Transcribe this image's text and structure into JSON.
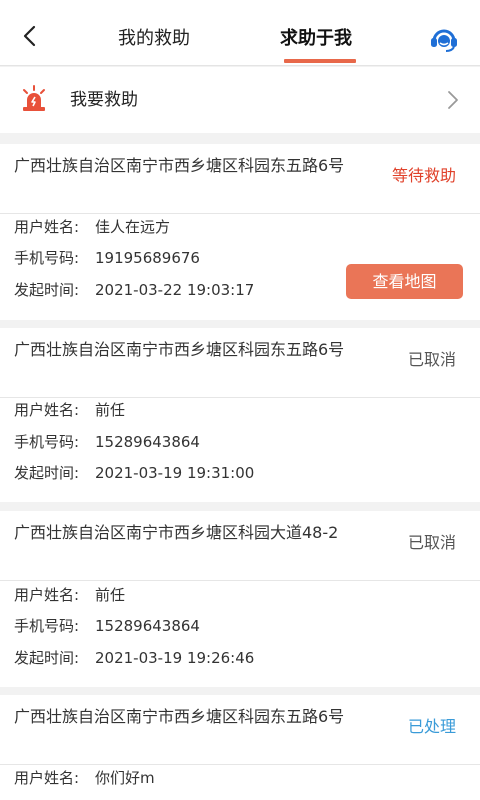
{
  "header": {
    "tabs": [
      {
        "label": "我的救助",
        "active": false
      },
      {
        "label": "求助于我",
        "active": true
      }
    ],
    "accent": "#e8684a"
  },
  "rescue_entry": {
    "label": "我要救助"
  },
  "field_labels": {
    "name": "用户姓名:",
    "phone": "手机号码:",
    "time": "发起时间:"
  },
  "map_button_label": "查看地图",
  "requests": [
    {
      "address": "广西壮族自治区南宁市西乡塘区科园东五路6号",
      "status": "等待救助",
      "name": "佳人在远方",
      "phone": "19195689676",
      "time": "2021-03-22 19:03:17"
    },
    {
      "address": "广西壮族自治区南宁市西乡塘区科园东五路6号",
      "status": "已取消",
      "name": "前任",
      "phone": "15289643864",
      "time": "2021-03-19 19:31:00"
    },
    {
      "address": "广西壮族自治区南宁市西乡塘区科园大道48-2",
      "status": "已取消",
      "name": "前任",
      "phone": "15289643864",
      "time": "2021-03-19 19:26:46"
    },
    {
      "address": "广西壮族自治区南宁市西乡塘区科园东五路6号",
      "status": "已处理",
      "name": "你们好m"
    }
  ],
  "status_colors": {
    "waiting": "#e0412a",
    "cancelled": "#555555",
    "processed": "#3a9bd8"
  }
}
